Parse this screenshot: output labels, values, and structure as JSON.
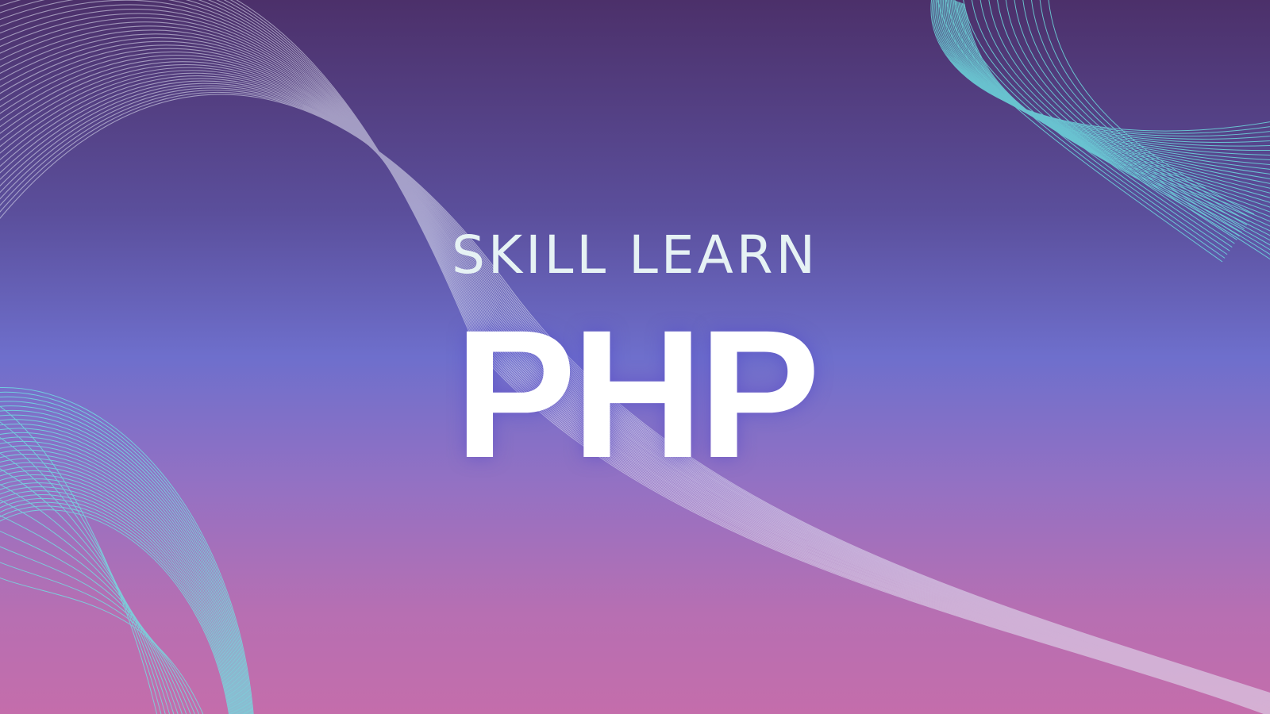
{
  "banner": {
    "subtitle": "SKILL LEARN",
    "title": "PHP"
  },
  "colors": {
    "gradient_top": "#4c306a",
    "gradient_middle": "#6e6fcc",
    "gradient_bottom": "#c46dab",
    "ribbon_white": "#e4e7f5",
    "ribbon_cyan": "#6fe3e3",
    "subtitle_text": "#e6f2f4",
    "title_text": "#ffffff"
  },
  "decorations": [
    "wave-ribbon",
    "cyan-mesh-top-right",
    "cyan-mesh-bottom-left"
  ]
}
